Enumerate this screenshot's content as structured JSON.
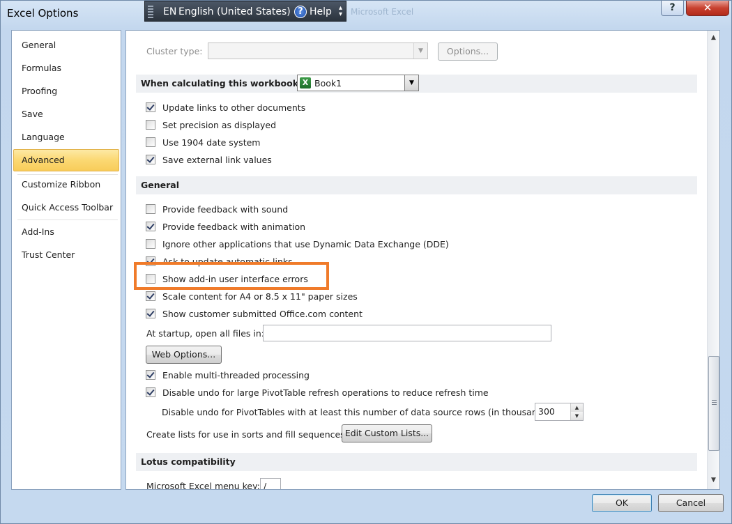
{
  "window": {
    "title": "Excel Options",
    "ghost_title": "Microsoft Excel",
    "help_button": "?",
    "close_button": "✕"
  },
  "language_bar": {
    "code": "EN",
    "language": "English (United States)",
    "help": "Help"
  },
  "sidebar": {
    "items": [
      {
        "label": "General"
      },
      {
        "label": "Formulas"
      },
      {
        "label": "Proofing"
      },
      {
        "label": "Save"
      },
      {
        "label": "Language"
      },
      {
        "label": "Advanced",
        "active": true
      },
      {
        "label": "Customize Ribbon"
      },
      {
        "label": "Quick Access Toolbar"
      },
      {
        "label": "Add-Ins"
      },
      {
        "label": "Trust Center"
      }
    ]
  },
  "content": {
    "cluster_type_label": "Cluster type:",
    "cluster_options_button": "Options...",
    "calc_section": {
      "header": "When calculating this workbook:",
      "workbook_select": "Book1",
      "options": [
        {
          "label": "Update links to other documents",
          "checked": true
        },
        {
          "label": "Set precision as displayed",
          "checked": false
        },
        {
          "label": "Use 1904 date system",
          "checked": false
        },
        {
          "label": "Save external link values",
          "checked": true
        }
      ]
    },
    "general_section": {
      "header": "General",
      "options": [
        {
          "label": "Provide feedback with sound",
          "checked": false
        },
        {
          "label": "Provide feedback with animation",
          "checked": true
        },
        {
          "label": "Ignore other applications that use Dynamic Data Exchange (DDE)",
          "checked": false
        },
        {
          "label": "Ask to update automatic links",
          "checked": true
        },
        {
          "label": "Show add-in user interface errors",
          "checked": false
        },
        {
          "label": "Scale content for A4 or 8.5 x 11\" paper sizes",
          "checked": true
        },
        {
          "label": "Show customer submitted Office.com content",
          "checked": true
        }
      ],
      "startup_label": "At startup, open all files in:",
      "startup_value": "",
      "web_options_button": "Web Options...",
      "multithread_label": "Enable multi-threaded processing",
      "multithread_checked": true,
      "disable_undo_label": "Disable undo for large PivotTable refresh operations to reduce refresh time",
      "disable_undo_checked": true,
      "undo_rows_label": "Disable undo for PivotTables with at least this number of data source rows (in thousands):",
      "undo_rows_value": "300",
      "custom_lists_label": "Create lists for use in sorts and fill sequences:",
      "custom_lists_button": "Edit Custom Lists..."
    },
    "lotus_section": {
      "header": "Lotus compatibility",
      "menu_key_label": "Microsoft Excel menu key:",
      "menu_key_value": "/"
    }
  },
  "footer": {
    "ok": "OK",
    "cancel": "Cancel"
  },
  "colors": {
    "highlight": "#f07b2a",
    "active_nav": "#fbd872"
  }
}
